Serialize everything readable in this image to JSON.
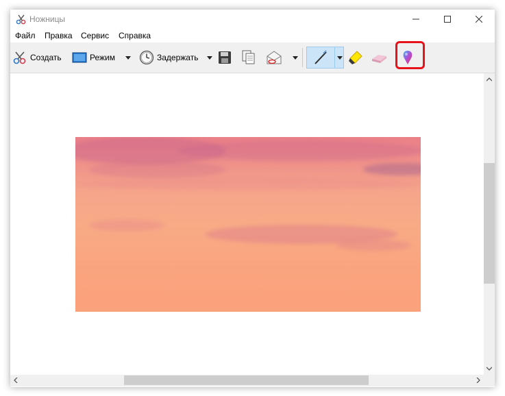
{
  "window": {
    "title": "Ножницы"
  },
  "menu": [
    "Файл",
    "Правка",
    "Сервис",
    "Справка"
  ],
  "toolbar": {
    "new_label": "Создать",
    "mode_label": "Режим",
    "delay_label": "Задержать"
  },
  "icons": {
    "app": "scissors-icon",
    "new": "scissors-icon",
    "mode": "rectangle-select-icon",
    "delay": "clock-icon",
    "save": "floppy-disk-icon",
    "copy": "copy-icon",
    "send": "envelope-icon",
    "pen": "pen-icon",
    "highlighter": "highlighter-icon",
    "eraser": "eraser-icon",
    "paint3d": "paint-3d-icon"
  },
  "colors": {
    "highlight_border": "#e8121a",
    "pen_active_bg": "#cce4f7"
  }
}
